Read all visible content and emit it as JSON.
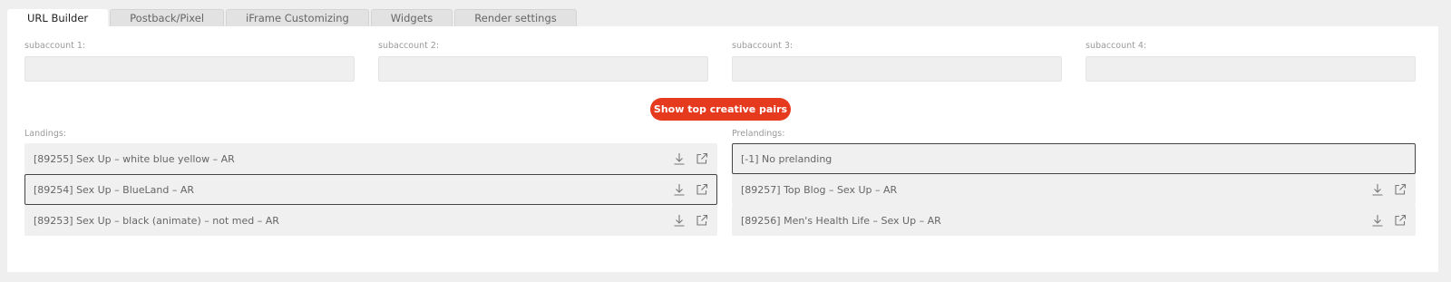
{
  "tabs": [
    {
      "label": "URL Builder"
    },
    {
      "label": "Postback/Pixel"
    },
    {
      "label": "iFrame Customizing"
    },
    {
      "label": "Widgets"
    },
    {
      "label": "Render settings"
    }
  ],
  "subaccounts": [
    {
      "label": "subaccount 1:",
      "value": ""
    },
    {
      "label": "subaccount 2:",
      "value": ""
    },
    {
      "label": "subaccount 3:",
      "value": ""
    },
    {
      "label": "subaccount 4:",
      "value": ""
    }
  ],
  "cta_label": "Show top creative pairs",
  "landings": {
    "label": "Landings:",
    "items": [
      {
        "text": "[89255] Sex Up – white blue yellow – AR"
      },
      {
        "text": "[89254] Sex Up – BlueLand – AR"
      },
      {
        "text": "[89253] Sex Up – black (animate) – not med – AR"
      }
    ]
  },
  "prelandings": {
    "label": "Prelandings:",
    "items": [
      {
        "text": "[-1] No prelanding"
      },
      {
        "text": "[89257] Top Blog – Sex Up – AR"
      },
      {
        "text": "[89256] Men's Health Life – Sex Up – AR"
      }
    ]
  },
  "icons": {
    "download": "download-icon",
    "open": "external-link-icon"
  }
}
